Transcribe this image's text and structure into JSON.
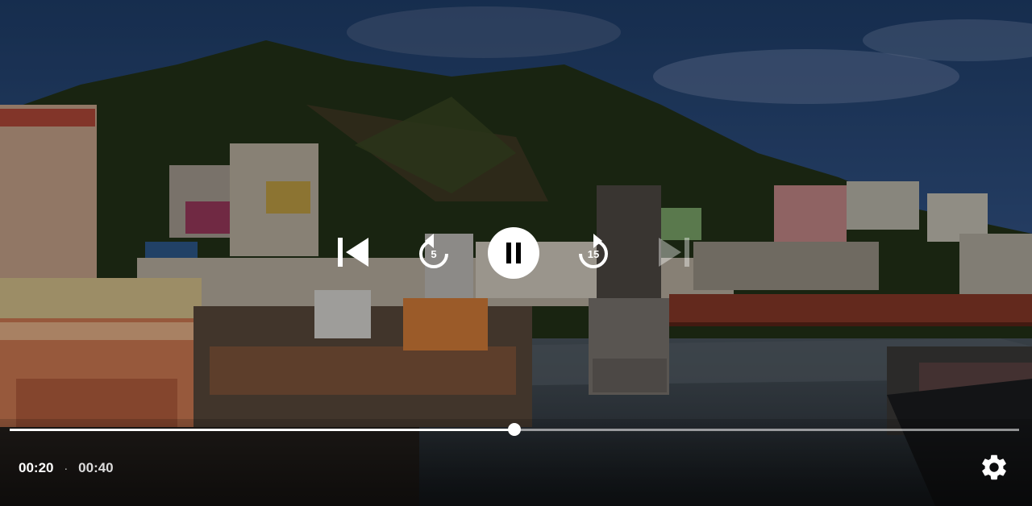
{
  "player": {
    "controls": {
      "previous_icon": "skip-previous-icon",
      "replay_icon": "replay-icon",
      "replay_seconds": "5",
      "pause_icon": "pause-icon",
      "forward_icon": "forward-icon",
      "forward_seconds": "15",
      "next_icon": "skip-next-icon",
      "next_enabled": false
    },
    "progress": {
      "fraction": 0.5
    },
    "time": {
      "current": "00:20",
      "separator": "·",
      "duration": "00:40"
    },
    "settings_icon": "gear-icon"
  }
}
